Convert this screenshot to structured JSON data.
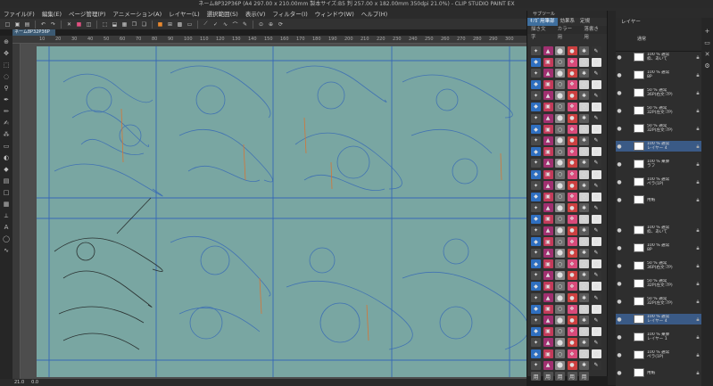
{
  "window": {
    "title": "ネーム8P32P36P (A4 297.00 x 210.00mm 製本サイズ:B5 判 257.00 x 182.00mm 350dpi 21.0%) - CLIP STUDIO PAINT EX"
  },
  "menu": [
    "ファイル(F)",
    "編集(E)",
    "ページ管理(P)",
    "アニメーション(A)",
    "レイヤー(L)",
    "選択範囲(S)",
    "表示(V)",
    "フィルター(I)",
    "ウィンドウ(W)",
    "ヘルプ(H)"
  ],
  "document_tab": "ネーム8P32P36P",
  "ruler_ticks": [
    "10",
    "20",
    "30",
    "40",
    "50",
    "60",
    "70",
    "80",
    "90",
    "100",
    "110",
    "120",
    "130",
    "140",
    "150",
    "160",
    "170",
    "180",
    "190",
    "200",
    "210",
    "220",
    "230",
    "240",
    "250",
    "260",
    "270",
    "280",
    "290",
    "300"
  ],
  "statusbar": [
    "21.0",
    "0.0"
  ],
  "subtool": {
    "header": "サブツール",
    "tabs": [
      "ｷﾉｶﾞ用筆部",
      "効果系",
      "定規"
    ],
    "active_tab": "ｷﾉｶﾞ用筆部",
    "tabs2": [
      "描き文字",
      "カラー用",
      "落書き用"
    ],
    "last_row_labels": [
      "用",
      "用",
      "用",
      "用",
      "用"
    ]
  },
  "layers": {
    "header": "レイヤー",
    "blend_mode": "通常",
    "items": [
      {
        "name": "100 % 通常\n枠、あいて",
        "thumb": "#ffffff",
        "mark": "",
        "selected": false
      },
      {
        "name": "100 % 通常\n8P",
        "thumb": "#ffffff",
        "mark": "",
        "selected": false
      },
      {
        "name": "50 % 通常\n36P(右文:7P)",
        "thumb": "#ffffff",
        "mark": "",
        "selected": false
      },
      {
        "name": "50 % 通常\n32P(左文:7P)",
        "thumb": "#ffffff",
        "mark": "",
        "selected": false
      },
      {
        "name": "50 % 通常\n32P(左文:7P)",
        "thumb": "#ffffff",
        "mark": "",
        "selected": false
      },
      {
        "name": "100 % 通常\nレイヤー 4",
        "thumb": "#ffffff",
        "mark": "",
        "selected": true
      },
      {
        "name": "100 % 乗算\nラフ",
        "thumb": "#ffffff",
        "mark": "",
        "selected": false
      },
      {
        "name": "100 % 通常\nペラ(1P)",
        "thumb": "#ffffff",
        "mark": "",
        "selected": false
      },
      {
        "name": "用紙",
        "thumb": "#ffffff",
        "mark": "",
        "selected": false
      },
      {
        "name": "100 % 通常\n枠、あいて",
        "thumb": "#ffffff",
        "mark": "",
        "selected": false
      },
      {
        "name": "100 % 通常\n8P",
        "thumb": "#ffffff",
        "mark": "",
        "selected": false
      },
      {
        "name": "50 % 通常\n36P(右文:7P)",
        "thumb": "#ffffff",
        "mark": "",
        "selected": false
      },
      {
        "name": "50 % 通常\n32P(左文:7P)",
        "thumb": "#ffffff",
        "mark": "",
        "selected": false
      },
      {
        "name": "50 % 通常\n32P(左文:7P)",
        "thumb": "#ffffff",
        "mark": "",
        "selected": false
      },
      {
        "name": "100 % 通常\nレイヤー 4",
        "thumb": "#ffffff",
        "mark": "",
        "selected": true
      },
      {
        "name": "100 % 乗算\nレイヤー 1",
        "thumb": "#ffffff",
        "mark": "",
        "selected": false
      },
      {
        "name": "100 % 通常\nペラ(1P)",
        "thumb": "#ffffff",
        "mark": "",
        "selected": false
      },
      {
        "name": "用紙",
        "thumb": "#ffffff",
        "mark": "",
        "selected": false
      }
    ]
  },
  "colors": {
    "paper": "#79a6a2",
    "sketch_blue": "#2f62b8",
    "sketch_black": "#1d1d1d",
    "sketch_orange": "#e0702a",
    "selected_layer": "#3a5a86"
  }
}
